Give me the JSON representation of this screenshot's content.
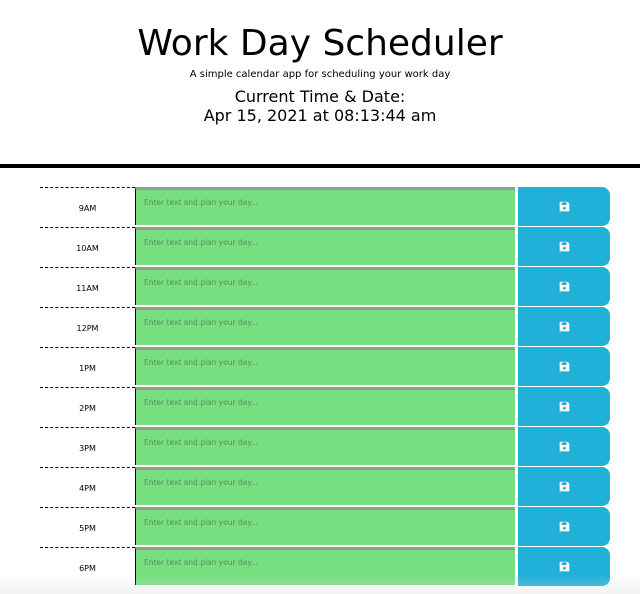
{
  "header": {
    "title": "Work Day Scheduler",
    "subtitle": "A simple calendar app for scheduling your work day",
    "time_label": "Current Time & Date:",
    "time_value": "Apr 15, 2021 at 08:13:44 am"
  },
  "colors": {
    "future_row": "#77df7f",
    "save_button": "#20b0d8"
  },
  "schedule": {
    "placeholder": "Enter text and plan your day...",
    "save_icon": "floppy-disk-icon",
    "rows": [
      {
        "hour": "9AM"
      },
      {
        "hour": "10AM"
      },
      {
        "hour": "11AM"
      },
      {
        "hour": "12PM"
      },
      {
        "hour": "1PM"
      },
      {
        "hour": "2PM"
      },
      {
        "hour": "3PM"
      },
      {
        "hour": "4PM"
      },
      {
        "hour": "5PM"
      },
      {
        "hour": "6PM"
      }
    ]
  }
}
